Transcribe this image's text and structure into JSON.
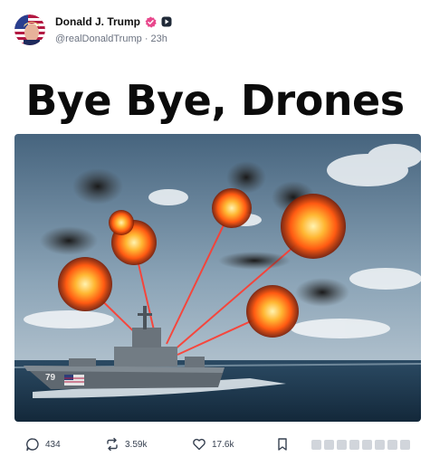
{
  "post": {
    "author_name": "Donald J. Trump",
    "handle": "@realDonaldTrump",
    "separator": "·",
    "time_ago": "23h",
    "headline": "Bye Bye, Drones",
    "image": {
      "hull_number": "79"
    }
  },
  "actions": {
    "replies": "434",
    "retruths": "3.59k",
    "likes": "17.6k"
  },
  "colors": {
    "verified": "#e8478c",
    "laser": "#ff3b2f"
  }
}
